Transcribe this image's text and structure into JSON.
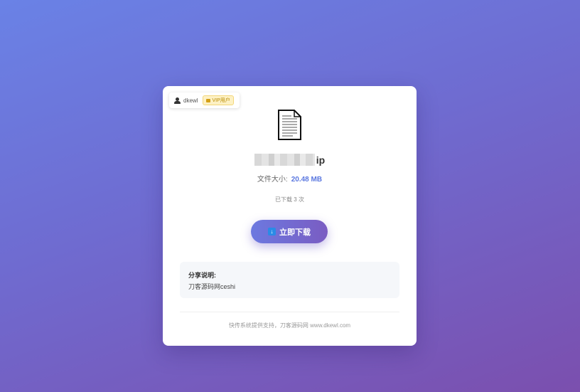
{
  "user": {
    "name": "dkewl",
    "badge": "VIP用户",
    "user_icon": "user-icon",
    "vip_icon": "vip-icon"
  },
  "file": {
    "icon": "document-icon",
    "name_suffix": "ip",
    "size_label": "文件大小:",
    "size_value": "20.48 MB",
    "download_count": "已下载 3 次"
  },
  "actions": {
    "download_label": "立即下载",
    "download_icon": "download-icon"
  },
  "share": {
    "title": "分享说明:",
    "description": "刀客源码网ceshi"
  },
  "footer": {
    "text": "快传系统提供支持，刀客源码网 www.dkewl.com"
  },
  "colors": {
    "accent": "#5b78e0",
    "button_start": "#6c79e0",
    "button_end": "#7a5cc2",
    "vip_bg": "#fdf1c4"
  }
}
